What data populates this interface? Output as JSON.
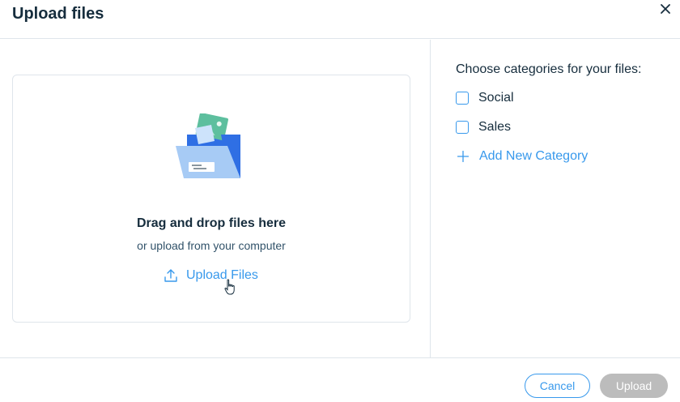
{
  "dialog": {
    "title": "Upload files",
    "close_icon": "close-icon"
  },
  "dropzone": {
    "illustration": "folder-with-image-illustration",
    "title": "Drag and drop files here",
    "subtitle": "or upload from your computer",
    "upload_link_label": "Upload Files",
    "upload_icon": "upload-icon"
  },
  "categories": {
    "heading": "Choose categories for your files:",
    "items": [
      {
        "label": "Social",
        "checked": false
      },
      {
        "label": "Sales",
        "checked": false
      }
    ],
    "add_label": "Add New Category",
    "add_icon": "plus-icon"
  },
  "footer": {
    "cancel_label": "Cancel",
    "upload_label": "Upload"
  },
  "colors": {
    "accent": "#3899ec",
    "text": "#162d3d",
    "disabled_button": "#bcbcbc",
    "divider": "#dfe5eb"
  }
}
